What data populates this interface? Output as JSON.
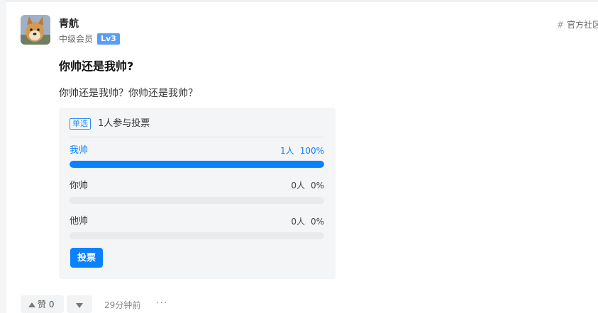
{
  "author": {
    "name": "青航",
    "member_level": "中级会员",
    "level_badge": "Lv3",
    "avatar_icon": "dog-avatar"
  },
  "community_tag": {
    "icon": "hash-icon",
    "label": "官方社区"
  },
  "post": {
    "title": "你帅还是我帅?",
    "body": "你帅还是我帅？你帅还是我帅？"
  },
  "poll": {
    "type_label": "单选",
    "participants": "1人参与投票",
    "options": [
      {
        "label": "我帅",
        "count": "1人",
        "percent": "100%",
        "fraction": 1.0,
        "selected": true
      },
      {
        "label": "你帅",
        "count": "0人",
        "percent": "0%",
        "fraction": 0.0,
        "selected": false
      },
      {
        "label": "他帅",
        "count": "0人",
        "percent": "0%",
        "fraction": 0.0,
        "selected": false
      }
    ],
    "vote_label": "投票",
    "accent_color": "#0a82ff"
  },
  "actions": {
    "like_icon": "triangle-up-icon",
    "like_label": "赞 0",
    "dislike_icon": "triangle-down-icon",
    "timestamp": "29分钟前",
    "more_icon": "ellipsis-icon",
    "more_label": "···"
  }
}
